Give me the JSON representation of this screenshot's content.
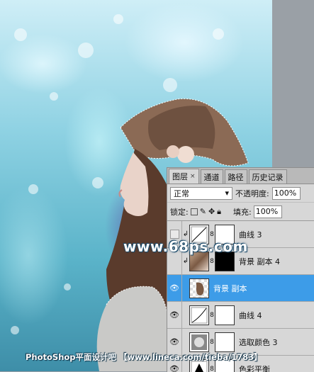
{
  "panel": {
    "tabs": [
      {
        "label": "图层",
        "close": "×"
      },
      {
        "label": "通道"
      },
      {
        "label": "路径"
      },
      {
        "label": "历史记录"
      }
    ],
    "blend_mode": "正常",
    "opacity_label": "不透明度:",
    "opacity_value": "100%",
    "lock_label": "锁定:",
    "fill_label": "填充:",
    "fill_value": "100%",
    "layers": [
      {
        "name": "曲线 3",
        "visible": false,
        "selected": false,
        "type": "adjustment-curves",
        "mask": "white",
        "clipped": true
      },
      {
        "name": "背景 副本 4",
        "visible": false,
        "selected": false,
        "type": "photo",
        "mask": "black",
        "clipped": true
      },
      {
        "name": "背景 副本",
        "visible": true,
        "selected": true,
        "type": "photo-transparent",
        "mask": "none",
        "clipped": false
      },
      {
        "name": "曲线 4",
        "visible": true,
        "selected": false,
        "type": "adjustment-curves",
        "mask": "white",
        "clipped": false
      },
      {
        "name": "选取颜色 3",
        "visible": true,
        "selected": false,
        "type": "adjustment-selective-color",
        "mask": "white",
        "clipped": false
      },
      {
        "name": "色彩平衡",
        "visible": true,
        "selected": false,
        "type": "adjustment-balance",
        "mask": "white",
        "clipped": false
      }
    ]
  },
  "watermarks": {
    "site": "www.68ps.com",
    "footer": "PhotoShop平面设计吧 【www.lineca.com/tieba/1783】"
  },
  "colors": {
    "selected_layer": "#3d9ce8",
    "panel_bg": "#d7d7d7"
  }
}
